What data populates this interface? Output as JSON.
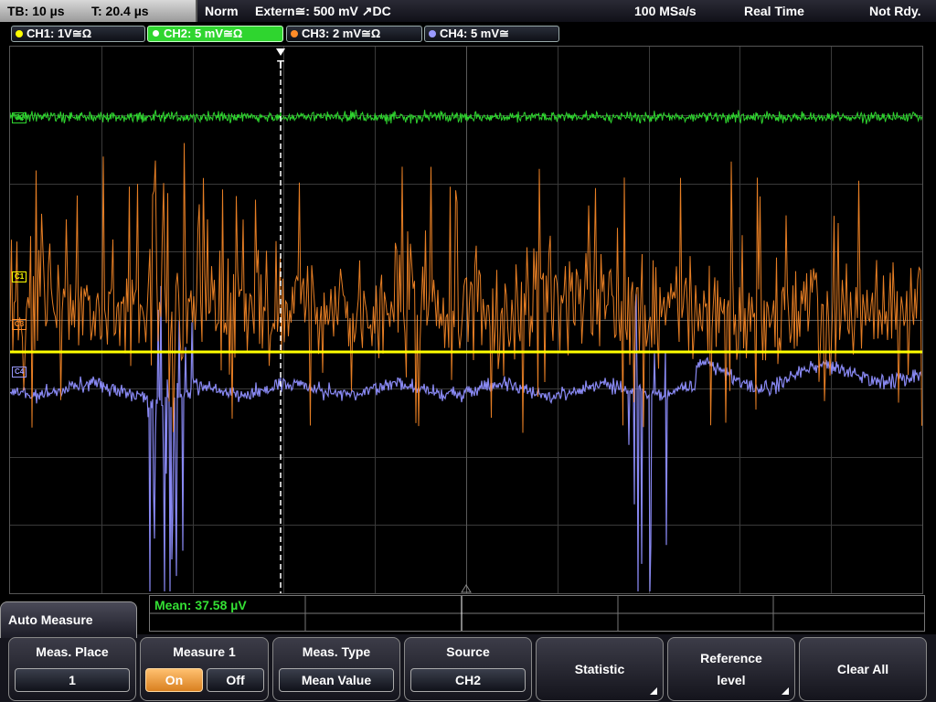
{
  "status": {
    "timebase": "TB: 10 µs",
    "trigger_time": "T: 20.4 µs",
    "trigger_mode": "Norm",
    "trigger_source": "Extern≅: 500 mV ↗DC",
    "sample_rate": "100 MSa/s",
    "acq_mode": "Real Time",
    "ready_state": "Not Rdy."
  },
  "channels": [
    {
      "label": "CH1: 1V≅Ω",
      "color": "#ffff00",
      "marker": "C1"
    },
    {
      "label": "CH2: 5 mV≅Ω",
      "color": "#2fd52f",
      "marker": "C2",
      "active": true
    },
    {
      "label": "CH3: 2 mV≅Ω",
      "color": "#ff8c28",
      "marker": "C3"
    },
    {
      "label": "CH4: 5 mV≅",
      "color": "#9a9aff",
      "marker": "C4"
    }
  ],
  "trigger_marker": "T",
  "measurement": {
    "readout": "Mean: 37.58 µV"
  },
  "menu": {
    "title": "Auto Measure",
    "meas_place": {
      "label": "Meas. Place",
      "value": "1"
    },
    "measure1": {
      "label": "Measure 1",
      "on": "On",
      "off": "Off"
    },
    "meas_type": {
      "label": "Meas. Type",
      "value": "Mean Value"
    },
    "source": {
      "label": "Source",
      "value": "CH2"
    },
    "statistic": {
      "label": "Statistic"
    },
    "reference": {
      "line1": "Reference",
      "line2": "level"
    },
    "clear_all": {
      "label": "Clear All"
    }
  }
}
